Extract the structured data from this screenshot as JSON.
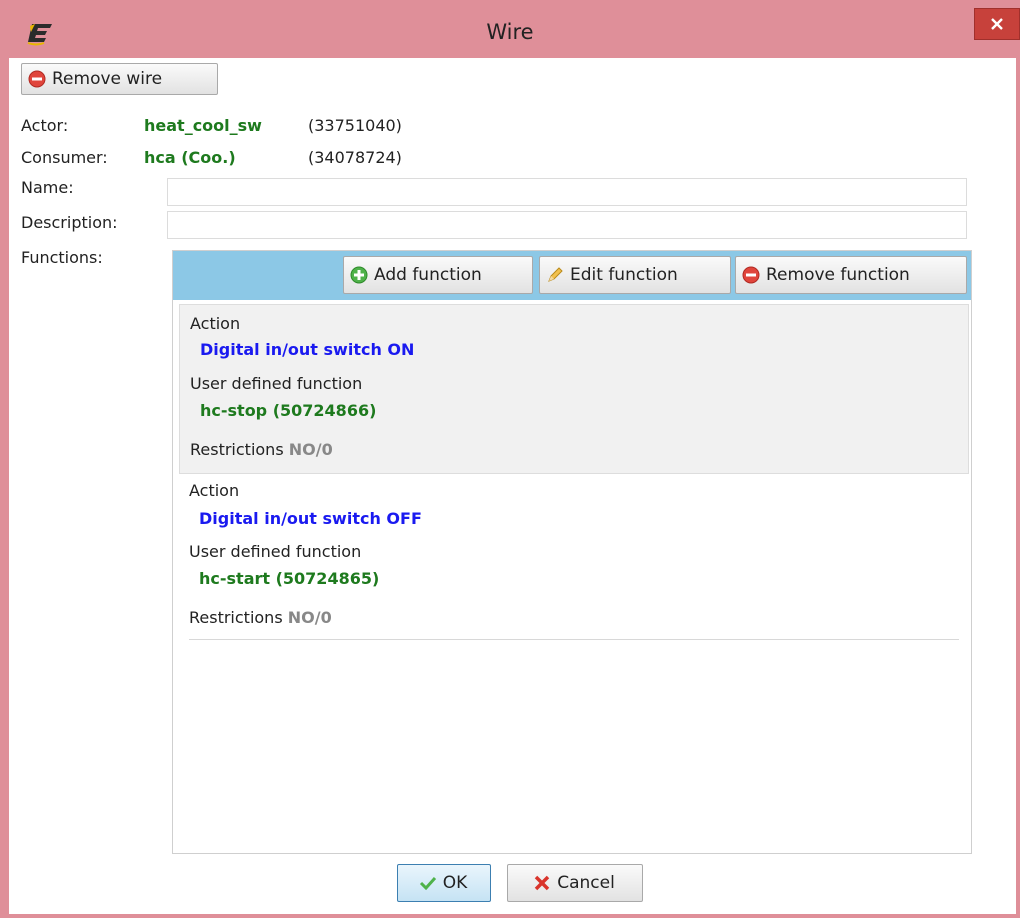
{
  "window": {
    "title": "Wire",
    "app_icon": "e-logo-icon",
    "close_icon": "close-icon"
  },
  "toolbar": {
    "remove_wire_label": "Remove wire",
    "remove_wire_icon": "remove-icon"
  },
  "form": {
    "actor_label": "Actor:",
    "actor_name": "heat_cool_sw",
    "actor_id": "(33751040)",
    "consumer_label": "Consumer:",
    "consumer_name": "hca (Coo.)",
    "consumer_id": "(34078724)",
    "name_label": "Name:",
    "name_value": "",
    "description_label": "Description:",
    "description_value": "",
    "functions_label": "Functions:"
  },
  "functions": {
    "add_label": "Add function",
    "edit_label": "Edit function",
    "remove_label": "Remove function",
    "items": [
      {
        "action_title": "Action",
        "action": "Digital in/out switch ON",
        "udf_title": "User defined function",
        "udf": "hc-stop (50724866)",
        "restrictions_label": "Restrictions",
        "restrictions_value": "NO/0",
        "selected": true
      },
      {
        "action_title": "Action",
        "action": "Digital in/out switch OFF",
        "udf_title": "User defined function",
        "udf": "hc-start (50724865)",
        "restrictions_label": "Restrictions",
        "restrictions_value": "NO/0",
        "selected": false
      }
    ]
  },
  "footer": {
    "ok_label": "OK",
    "cancel_label": "Cancel"
  },
  "colors": {
    "title_bar": "#df8f99",
    "toolbar_bg": "#8cc8e6",
    "green_value": "#1e7a1e",
    "blue_action": "#1a1af0",
    "close_button": "#c7413b"
  }
}
